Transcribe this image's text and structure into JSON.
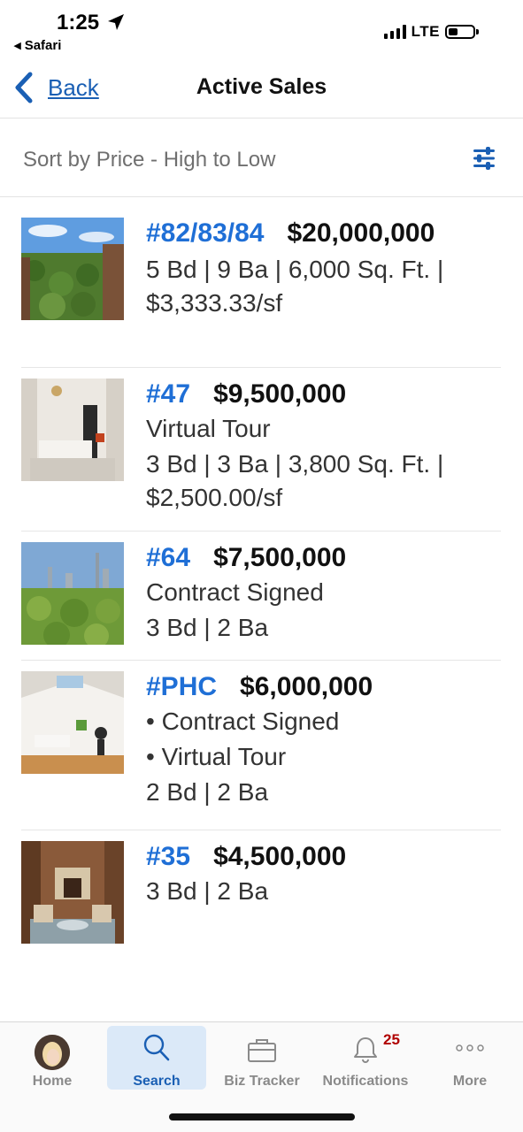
{
  "status_bar": {
    "time": "1:25",
    "back_app": "◂ Safari",
    "network": "LTE"
  },
  "nav": {
    "back_label": "Back",
    "title": "Active Sales"
  },
  "sort": {
    "label": "Sort by Price - High to Low"
  },
  "listings": [
    {
      "unit": "#82/83/84",
      "price": "$20,000,000",
      "lines": [
        "5 Bd | 9 Ba | 6,000 Sq. Ft. | $3,333.33/sf"
      ],
      "thumb": "park-view"
    },
    {
      "unit": "#47",
      "price": "$9,500,000",
      "lines": [
        "Virtual Tour",
        "3 Bd | 3 Ba | 3,800 Sq. Ft. | $2,500.00/sf"
      ],
      "thumb": "living-room"
    },
    {
      "unit": "#64",
      "price": "$7,500,000",
      "lines": [
        "Contract Signed",
        "3 Bd | 2 Ba"
      ],
      "thumb": "skyline"
    },
    {
      "unit": "#PHC",
      "price": "$6,000,000",
      "lines": [
        "• Contract Signed",
        "• Virtual Tour",
        "2 Bd | 2 Ba"
      ],
      "thumb": "penthouse"
    },
    {
      "unit": "#35",
      "price": "$4,500,000",
      "lines": [
        "3 Bd | 2 Ba"
      ],
      "thumb": "library-room"
    }
  ],
  "tabbar": {
    "home": "Home",
    "search": "Search",
    "biz_tracker": "Biz Tracker",
    "notifications": "Notifications",
    "notifications_badge": "25",
    "more": "More",
    "active_tab": "Search"
  },
  "colors": {
    "accent": "#1a5fb4",
    "unit_link": "#1f6fd6",
    "badge": "#b00000",
    "active_tab_bg": "#dbe9f8"
  }
}
